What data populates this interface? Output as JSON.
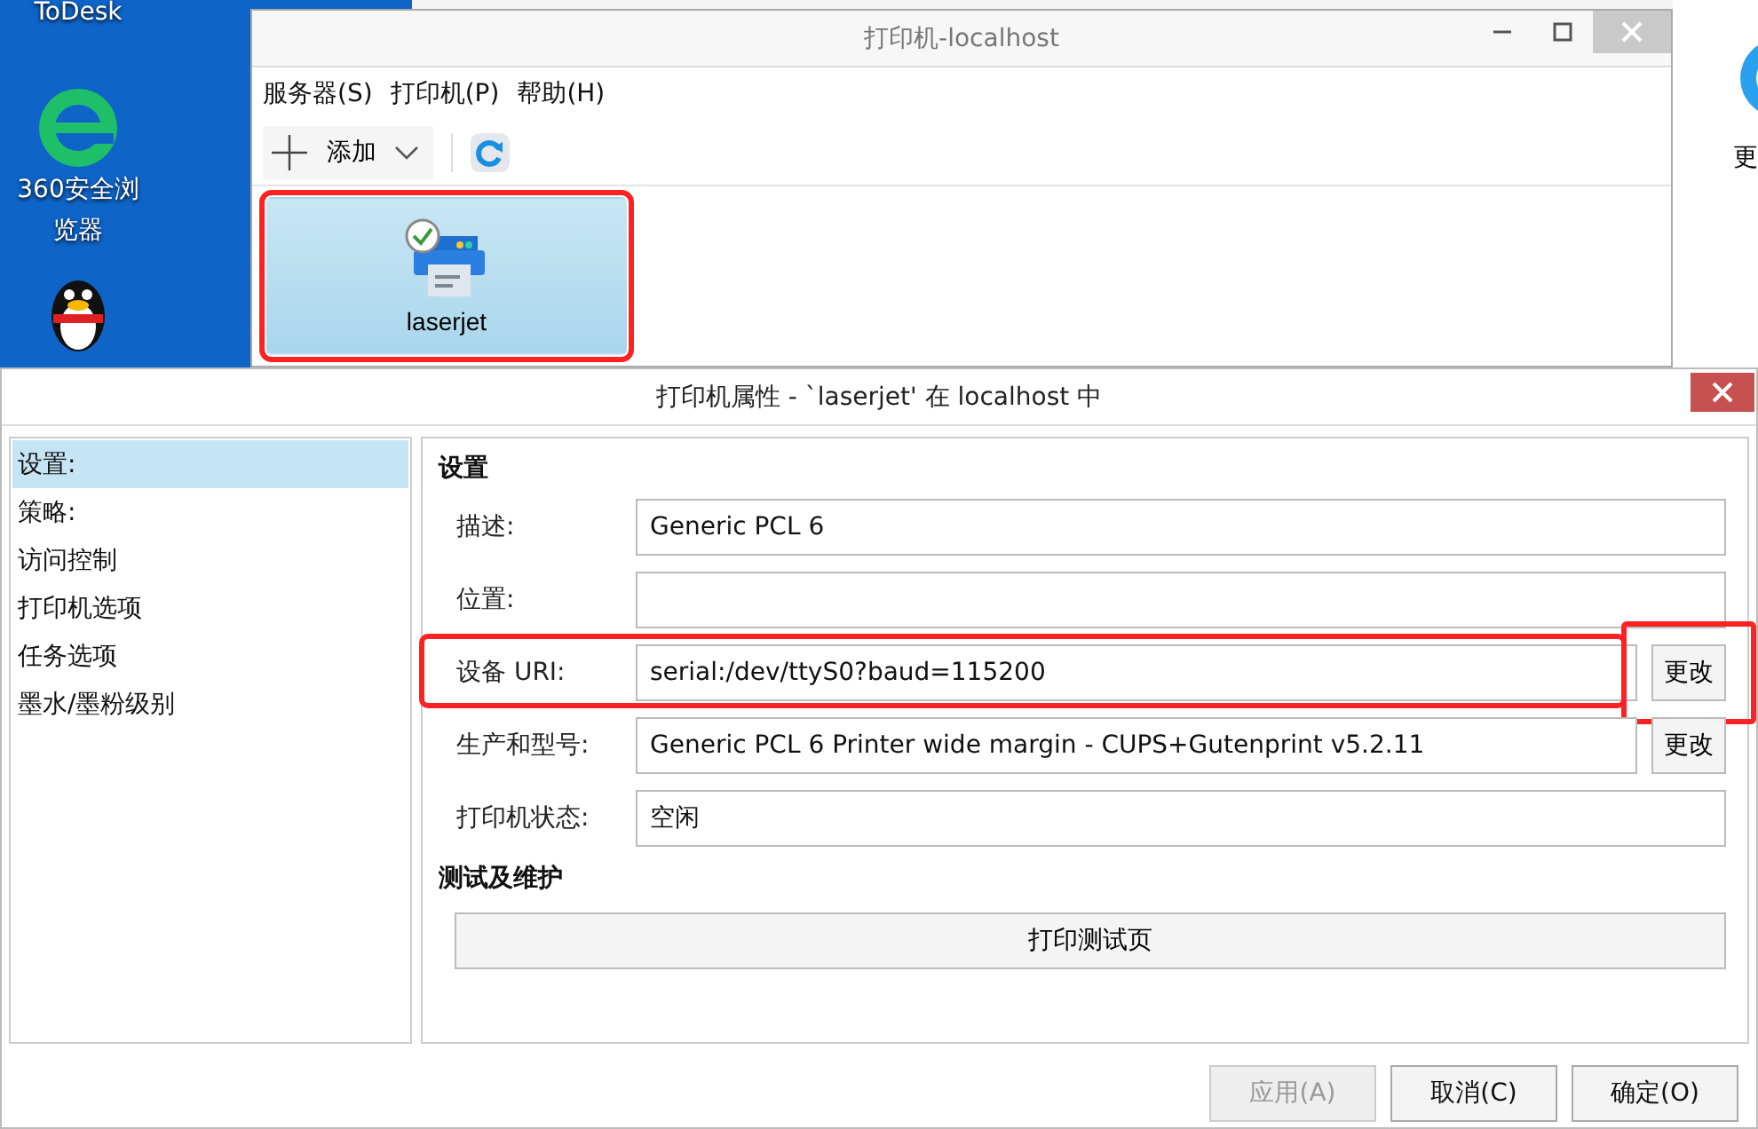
{
  "desktop": {
    "icons": [
      {
        "kind": "text-only",
        "label": "ToDesk"
      },
      {
        "kind": "browser",
        "label": "360安全浏览器"
      },
      {
        "kind": "penguin"
      }
    ],
    "right_icon": {
      "label": "更"
    }
  },
  "main_window": {
    "title": "打印机-localhost",
    "menu": [
      "服务器(S)",
      "打印机(P)",
      "帮助(H)"
    ],
    "toolbar": {
      "add_label": "添加"
    },
    "printers": [
      {
        "name": "laserjet",
        "selected": true,
        "highlighted": true
      }
    ]
  },
  "dialog": {
    "title": "打印机属性 - `laserjet' 在 localhost 中",
    "sidebar": [
      {
        "label": "设置:",
        "selected": true
      },
      {
        "label": "策略:",
        "selected": false
      },
      {
        "label": "访问控制",
        "selected": false
      },
      {
        "label": "打印机选项",
        "selected": false
      },
      {
        "label": "任务选项",
        "selected": false
      },
      {
        "label": "墨水/墨粉级别",
        "selected": false
      }
    ],
    "section_title": "设置",
    "fields": [
      {
        "label": "描述:",
        "value": "Generic PCL 6",
        "highlighted": false
      },
      {
        "label": "位置:",
        "highlighted": false
      },
      {
        "label": "设备 URI:",
        "value": "serial:/dev/ttyS0?baud=115200",
        "button": "更改",
        "highlighted": true
      },
      {
        "label": "生产和型号:",
        "value": "Generic PCL 6 Printer wide margin - CUPS+Gutenprint v5.2.11",
        "button": "更改",
        "highlighted": false
      },
      {
        "label": "打印机状态:",
        "value": "空闲",
        "highlighted": false
      }
    ],
    "maintenance_title": "测试及维护",
    "test_button": "打印测试页",
    "buttons": [
      {
        "label": "应用(A)",
        "disabled": true
      },
      {
        "label": "取消(C)",
        "disabled": false
      },
      {
        "label": "确定(O)",
        "disabled": false
      }
    ]
  }
}
